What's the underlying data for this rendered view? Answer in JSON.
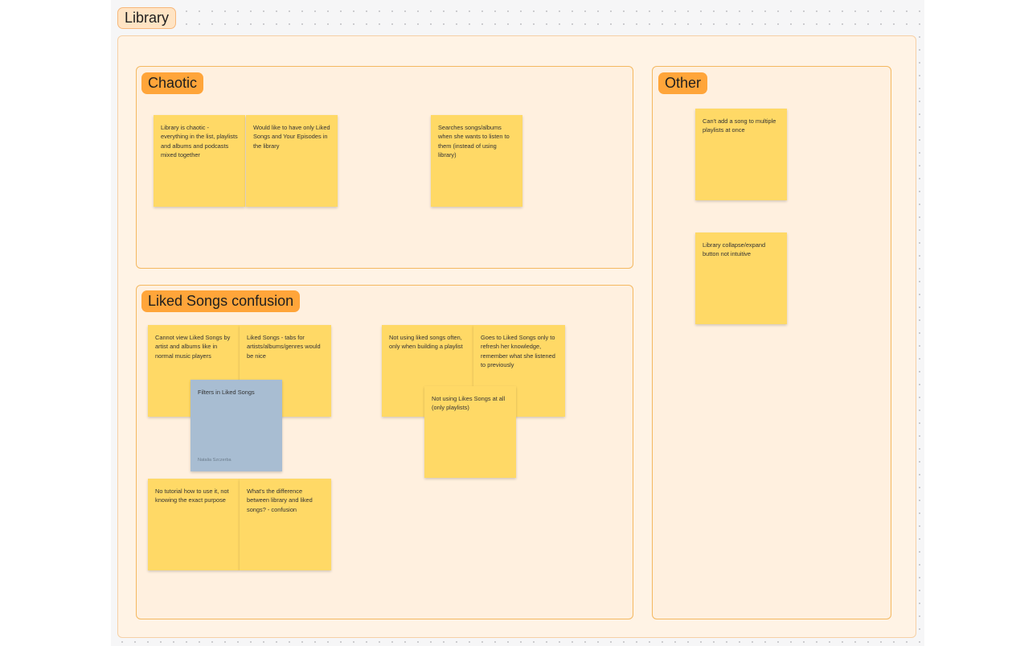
{
  "board": {
    "section_title": "Library"
  },
  "groups": {
    "chaotic": {
      "title": "Chaotic",
      "notes": [
        "Library is chaotic - everything in the list, playlists and albums and podcasts mixed together",
        "Would like to have only Liked Songs and Your Episodes in the library",
        "Searches songs/albums when she wants to listen to them (instead of using library)"
      ]
    },
    "other": {
      "title": "Other",
      "notes": [
        "Can't add a song to multiple playlists at once",
        "Library collapse/expand button not intuitive"
      ]
    },
    "liked_songs": {
      "title": "Liked Songs confusion",
      "notes": [
        "Cannot view Liked Songs by artist and albums like in normal music players",
        "Liked Songs - tabs for artists/albums/genres would be nice",
        "No tutorial how to use it, not knowing the exact purpose",
        "What's the difference between library and liked songs? - confusion",
        "Not using liked songs often, only when building a playlist",
        "Goes to Liked Songs only to refresh her knowledge, remember what she listened to previously",
        "Not using Likes Songs at all (only playlists)"
      ],
      "blue_note": {
        "text": "Filters in Liked Songs",
        "author": "Natalia Szczerba"
      }
    }
  },
  "colors": {
    "sticky_yellow": "#ffd966",
    "sticky_blue": "#a8bdd2",
    "tag_orange": "#ffa53a",
    "frame_border": "#f4b860"
  }
}
